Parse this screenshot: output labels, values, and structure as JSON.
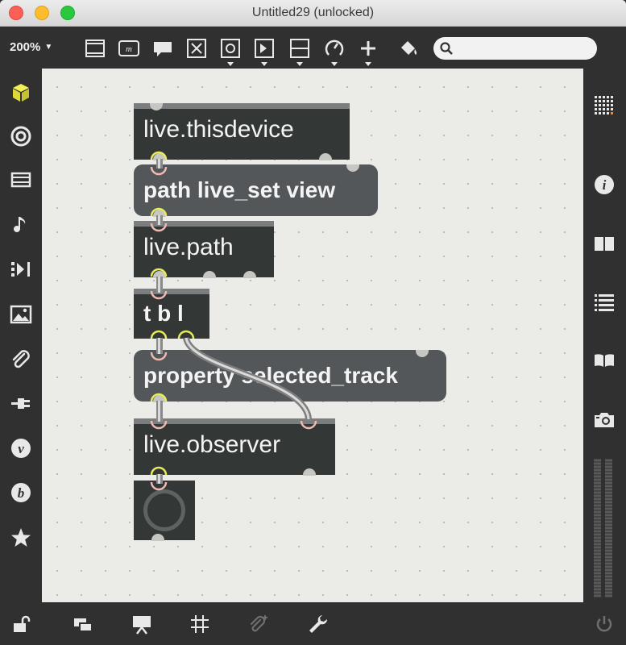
{
  "window": {
    "title": "Untitled29 (unlocked)"
  },
  "toolbar": {
    "zoom": "200%",
    "tools": [
      "object-box",
      "message-box",
      "comment",
      "button",
      "toggle",
      "number",
      "slider",
      "dial",
      "new-object",
      "paint-bucket"
    ],
    "search_placeholder": ""
  },
  "left_sidebar": {
    "icons": [
      "package-cube-icon",
      "target-icon",
      "browser-icon",
      "music-note-icon",
      "sequencer-icon",
      "image-icon",
      "paperclip-icon",
      "plug-icon",
      "vizzie-icon",
      "beap-icon",
      "star-icon"
    ]
  },
  "right_sidebar": {
    "icons": [
      "grid-icon",
      "info-icon",
      "reference-icon",
      "list-icon",
      "book-icon",
      "camera-icon"
    ]
  },
  "patch": {
    "objects": [
      {
        "id": "live-thisdevice",
        "text": "live.thisdevice",
        "kind": "object"
      },
      {
        "id": "path-live-set-view",
        "text": "path live_set view",
        "kind": "message"
      },
      {
        "id": "live-path",
        "text": "live.path",
        "kind": "object"
      },
      {
        "id": "t-b-l",
        "text": "t b l",
        "kind": "object"
      },
      {
        "id": "property-selected-track",
        "text": "property selected_track",
        "kind": "message"
      },
      {
        "id": "live-observer",
        "text": "live.observer",
        "kind": "object"
      },
      {
        "id": "dial",
        "text": "",
        "kind": "ui"
      }
    ]
  },
  "bottom_bar": {
    "icons": [
      "lock-icon",
      "windows-icon",
      "presentation-icon",
      "grid-snap-icon",
      "paperclip-add-icon",
      "wrench-icon",
      "power-icon"
    ]
  },
  "colors": {
    "accent_yellow": "#e8ec5a",
    "inlet_highlight": "#f0b9b2",
    "object_bg": "#333836",
    "message_bg": "#535759",
    "canvas_bg": "#ebebe7"
  }
}
